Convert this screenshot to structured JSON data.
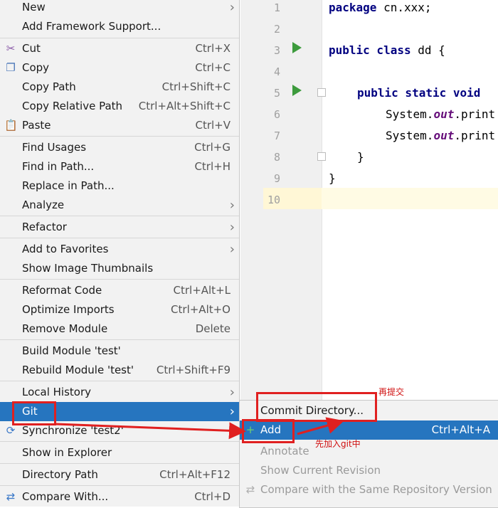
{
  "editor": {
    "line_numbers": [
      "1",
      "2",
      "3",
      "4",
      "5",
      "6",
      "7",
      "8",
      "9",
      "10"
    ],
    "code": {
      "line1_kw": "package",
      "line1_rest": " cn.xxx;",
      "line3_kw": "public class",
      "line3_rest": " dd {",
      "line5_kw": "public static void",
      "line6_pre": "System.",
      "line6_field": "out",
      "line6_post": ".print",
      "line7_pre": "System.",
      "line7_field": "out",
      "line7_post": ".print",
      "line8": "}",
      "line9": "}"
    }
  },
  "menu": {
    "items": [
      {
        "label": "New",
        "submenu": true
      },
      {
        "label": "Add Framework Support..."
      },
      {
        "label": "Cut",
        "shortcut": "Ctrl+X",
        "icon": "scissors-icon"
      },
      {
        "label": "Copy",
        "shortcut": "Ctrl+C",
        "icon": "copy-icon"
      },
      {
        "label": "Copy Path",
        "shortcut": "Ctrl+Shift+C"
      },
      {
        "label": "Copy Relative Path",
        "shortcut": "Ctrl+Alt+Shift+C"
      },
      {
        "label": "Paste",
        "shortcut": "Ctrl+V",
        "icon": "paste-icon"
      },
      {
        "label": "Find Usages",
        "shortcut": "Ctrl+G"
      },
      {
        "label": "Find in Path...",
        "shortcut": "Ctrl+H"
      },
      {
        "label": "Replace in Path..."
      },
      {
        "label": "Analyze",
        "submenu": true
      },
      {
        "label": "Refactor",
        "submenu": true
      },
      {
        "label": "Add to Favorites",
        "submenu": true
      },
      {
        "label": "Show Image Thumbnails"
      },
      {
        "label": "Reformat Code",
        "shortcut": "Ctrl+Alt+L"
      },
      {
        "label": "Optimize Imports",
        "shortcut": "Ctrl+Alt+O"
      },
      {
        "label": "Remove Module",
        "shortcut": "Delete"
      },
      {
        "label": "Build Module 'test'"
      },
      {
        "label": "Rebuild Module 'test'",
        "shortcut": "Ctrl+Shift+F9"
      },
      {
        "label": "Local History",
        "submenu": true
      },
      {
        "label": "Git",
        "submenu": true,
        "selected": true
      },
      {
        "label": "Synchronize 'test2'",
        "icon": "sync-icon"
      },
      {
        "label": "Show in Explorer"
      },
      {
        "label": "Directory Path",
        "shortcut": "Ctrl+Alt+F12"
      },
      {
        "label": "Compare With...",
        "shortcut": "Ctrl+D",
        "icon": "compare-icon"
      }
    ]
  },
  "git_submenu": {
    "items": [
      {
        "label": "Commit Directory..."
      },
      {
        "label": "Add",
        "shortcut": "Ctrl+Alt+A",
        "selected": true,
        "icon": "plus-icon"
      },
      {
        "label": "Annotate",
        "disabled": true
      },
      {
        "label": "Show Current Revision",
        "disabled": true
      },
      {
        "label": "Compare with the Same Repository Version",
        "disabled": true,
        "icon": "compare-icon"
      }
    ]
  },
  "annotations": {
    "commit_note": "再提交",
    "add_note": "先加入git中"
  },
  "colors": {
    "selection": "#2675bf",
    "annotation_red": "#e02020",
    "run_green": "#3d9b3d",
    "keyword": "#000080"
  }
}
